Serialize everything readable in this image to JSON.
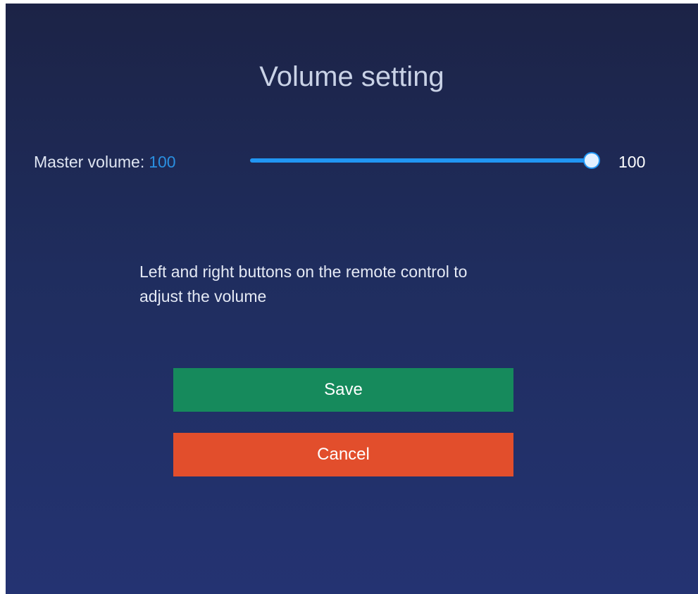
{
  "dialog": {
    "title": "Volume setting"
  },
  "master_volume": {
    "label": "Master volume:",
    "value_text": "100",
    "slider_value": 100,
    "slider_max": 100,
    "right_value_text": "100"
  },
  "hint_text": "Left and right buttons on the remote control to adjust the volume",
  "buttons": {
    "save_label": "Save",
    "cancel_label": "Cancel"
  },
  "colors": {
    "accent": "#2196f3",
    "save": "#168a5c",
    "cancel": "#e24e2c",
    "background": "#1f2d5e"
  }
}
